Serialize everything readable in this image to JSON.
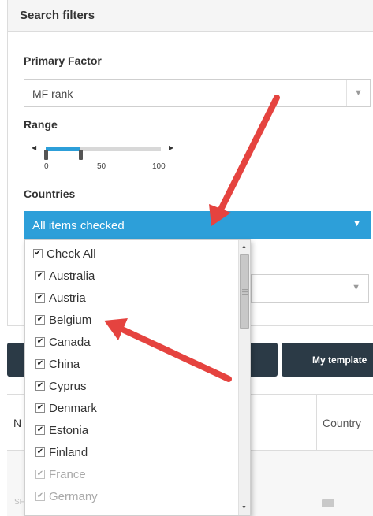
{
  "panel": {
    "title": "Search filters"
  },
  "primary_factor": {
    "label": "Primary Factor",
    "value": "MF rank"
  },
  "range": {
    "label": "Range",
    "ticks": [
      "0",
      "50",
      "100"
    ],
    "low": 0,
    "high": 30
  },
  "countries": {
    "label": "Countries",
    "value": "All items checked",
    "check_all": "Check All",
    "items": [
      {
        "label": "Australia",
        "checked": true
      },
      {
        "label": "Austria",
        "checked": true
      },
      {
        "label": "Belgium",
        "checked": true
      },
      {
        "label": "Canada",
        "checked": true
      },
      {
        "label": "China",
        "checked": true
      },
      {
        "label": "Cyprus",
        "checked": true
      },
      {
        "label": "Denmark",
        "checked": true
      },
      {
        "label": "Estonia",
        "checked": true
      },
      {
        "label": "Finland",
        "checked": true
      },
      {
        "label": "France",
        "checked": true
      },
      {
        "label": "Germany",
        "checked": true
      }
    ]
  },
  "buttons": {
    "templates": "My template"
  },
  "table": {
    "col_n": "N",
    "col_country": "Country",
    "row_text": "SF"
  },
  "colors": {
    "accent": "#2d9fd9",
    "dark_button": "#2b3a46",
    "arrow": "#e5433f"
  }
}
